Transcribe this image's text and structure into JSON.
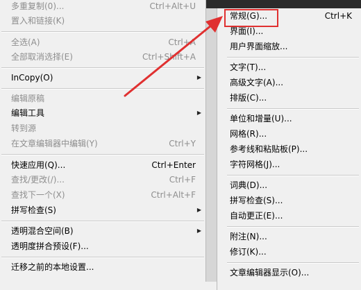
{
  "left_menu": {
    "items": [
      {
        "label": "多重复制(0)...",
        "shortcut": "Ctrl+Alt+U"
      },
      {
        "label": "置入和链接(K)",
        "shortcut": ""
      },
      {
        "label": "全选(A)",
        "shortcut": "Ctrl+A"
      },
      {
        "label": "全部取消选择(E)",
        "shortcut": "Ctrl+Shift+A"
      },
      {
        "label": "InCopy(O)",
        "shortcut": ""
      },
      {
        "label": "编辑原稿",
        "shortcut": ""
      },
      {
        "label": "编辑工具",
        "shortcut": ""
      },
      {
        "label": "转到源",
        "shortcut": ""
      },
      {
        "label": "在文章编辑器中编辑(Y)",
        "shortcut": "Ctrl+Y"
      },
      {
        "label": "快速应用(Q)...",
        "shortcut": "Ctrl+Enter"
      },
      {
        "label": "查找/更改(/)...",
        "shortcut": "Ctrl+F"
      },
      {
        "label": "查找下一个(X)",
        "shortcut": "Ctrl+Alt+F"
      },
      {
        "label": "拼写检查(S)",
        "shortcut": ""
      },
      {
        "label": "透明混合空间(B)",
        "shortcut": ""
      },
      {
        "label": "透明度拼合预设(F)...",
        "shortcut": ""
      },
      {
        "label": "迁移之前的本地设置...",
        "shortcut": ""
      }
    ]
  },
  "right_menu": {
    "items": [
      {
        "label": "常规(G)...",
        "shortcut": "Ctrl+K"
      },
      {
        "label": "界面(I)...",
        "shortcut": ""
      },
      {
        "label": "用户界面缩放...",
        "shortcut": ""
      },
      {
        "label": "文字(T)...",
        "shortcut": ""
      },
      {
        "label": "高级文字(A)...",
        "shortcut": ""
      },
      {
        "label": "排版(C)...",
        "shortcut": ""
      },
      {
        "label": "单位和增量(U)...",
        "shortcut": ""
      },
      {
        "label": "网格(R)...",
        "shortcut": ""
      },
      {
        "label": "参考线和粘贴板(P)...",
        "shortcut": ""
      },
      {
        "label": "字符网格(J)...",
        "shortcut": ""
      },
      {
        "label": "词典(D)...",
        "shortcut": ""
      },
      {
        "label": "拼写检查(S)...",
        "shortcut": ""
      },
      {
        "label": "自动更正(E)...",
        "shortcut": ""
      },
      {
        "label": "附注(N)...",
        "shortcut": ""
      },
      {
        "label": "修订(K)...",
        "shortcut": ""
      },
      {
        "label": "文章编辑器显示(O)...",
        "shortcut": ""
      }
    ]
  },
  "colors": {
    "annotation": "#e03030",
    "disabled_text": "#8e8e8e"
  }
}
